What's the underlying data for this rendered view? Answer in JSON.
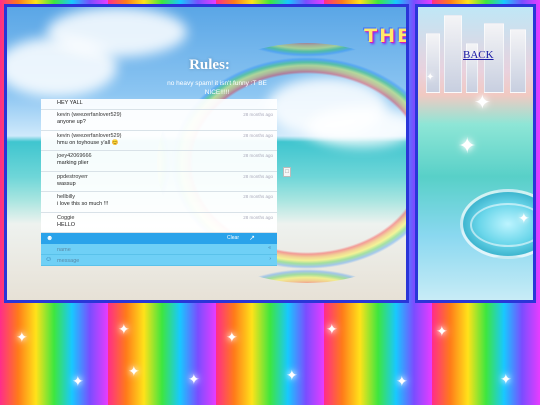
{
  "header": {
    "marquee": "THE"
  },
  "rules": {
    "title": "Rules:",
    "text": "no heavy spam! it isn't funny :T BE NICE!!!!!"
  },
  "chat": {
    "pinned": "HEY YALL",
    "messages": [
      {
        "name": "kevin (weezerfanlover529)",
        "text": "anyone up?",
        "time": "28 months ago"
      },
      {
        "name": "kevin (weezerfanlover529)",
        "text": "hmu on toyhouse y'all 😊",
        "time": "28 months ago"
      },
      {
        "name": "joey42069666",
        "text": "marking plier",
        "time": "28 months ago"
      },
      {
        "name": "ppdestroyerr",
        "text": "wassup",
        "time": "28 months ago"
      },
      {
        "name": "hellbilly",
        "text": "i love this so much !!!",
        "time": "28 months ago"
      },
      {
        "name": "Coggie",
        "text": "HELLO",
        "time": "28 months ago"
      }
    ],
    "clear_label": "Clear",
    "name_placeholder": "name",
    "message_placeholder": "message"
  },
  "sidebar": {
    "back_label": "BACK"
  },
  "icons": {
    "user": "user-icon",
    "popout": "external-link-icon",
    "smiley": "smiley-icon"
  },
  "colors": {
    "panel_border": "#2a35d8",
    "chat_bar": "#2aa3ea",
    "chat_field": "#6fd0f6",
    "back_link": "#1a1aa6"
  }
}
